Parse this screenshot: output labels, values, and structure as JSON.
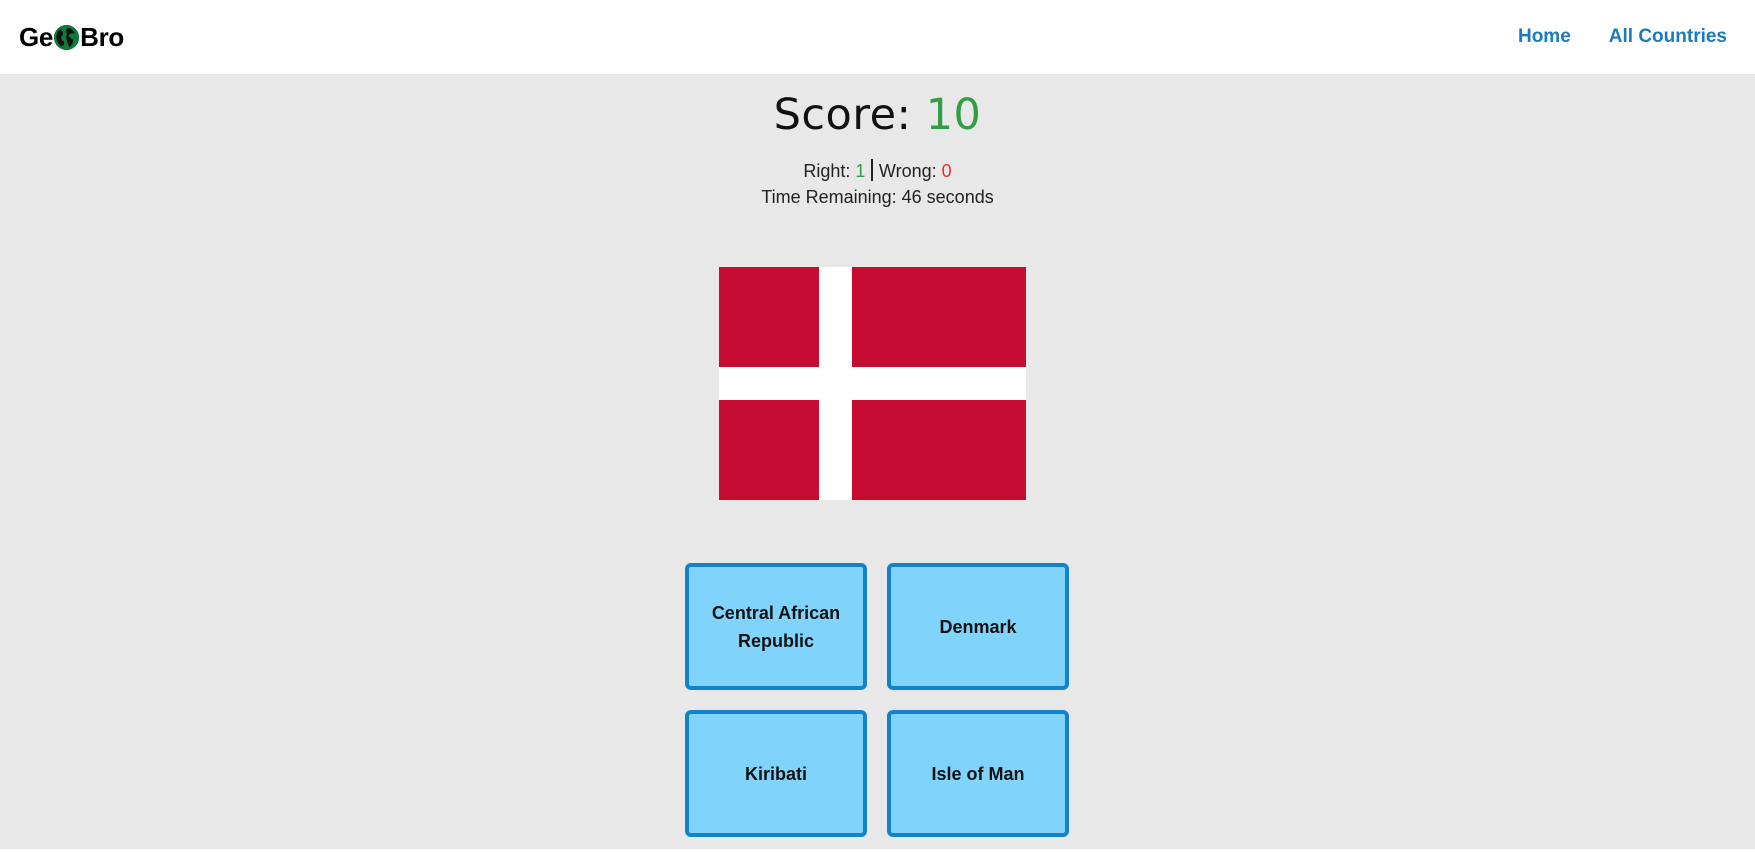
{
  "header": {
    "logo_left": "Ge",
    "logo_right": "Bro",
    "logo_icon": "globe-icon",
    "nav": [
      "Home",
      "All Countries"
    ]
  },
  "quiz": {
    "score_label": "Score:",
    "score_value": "10",
    "right_label": "Right:",
    "right_value": "1",
    "wrong_label": "Wrong:",
    "wrong_value": "0",
    "timer_text": "Time Remaining: 46 seconds",
    "flag": "denmark-flag",
    "answers": [
      "Central African Republic",
      "Denmark",
      "Kiribati",
      "Isle of Man"
    ]
  },
  "colors": {
    "link": "#1a7bbf",
    "score": "#2f9e44",
    "wrong": "#e03131",
    "answer_bg": "#80d4fb",
    "answer_border": "#1283c8",
    "flag_red": "#c60c30",
    "page_bg": "#e8e8e8"
  }
}
